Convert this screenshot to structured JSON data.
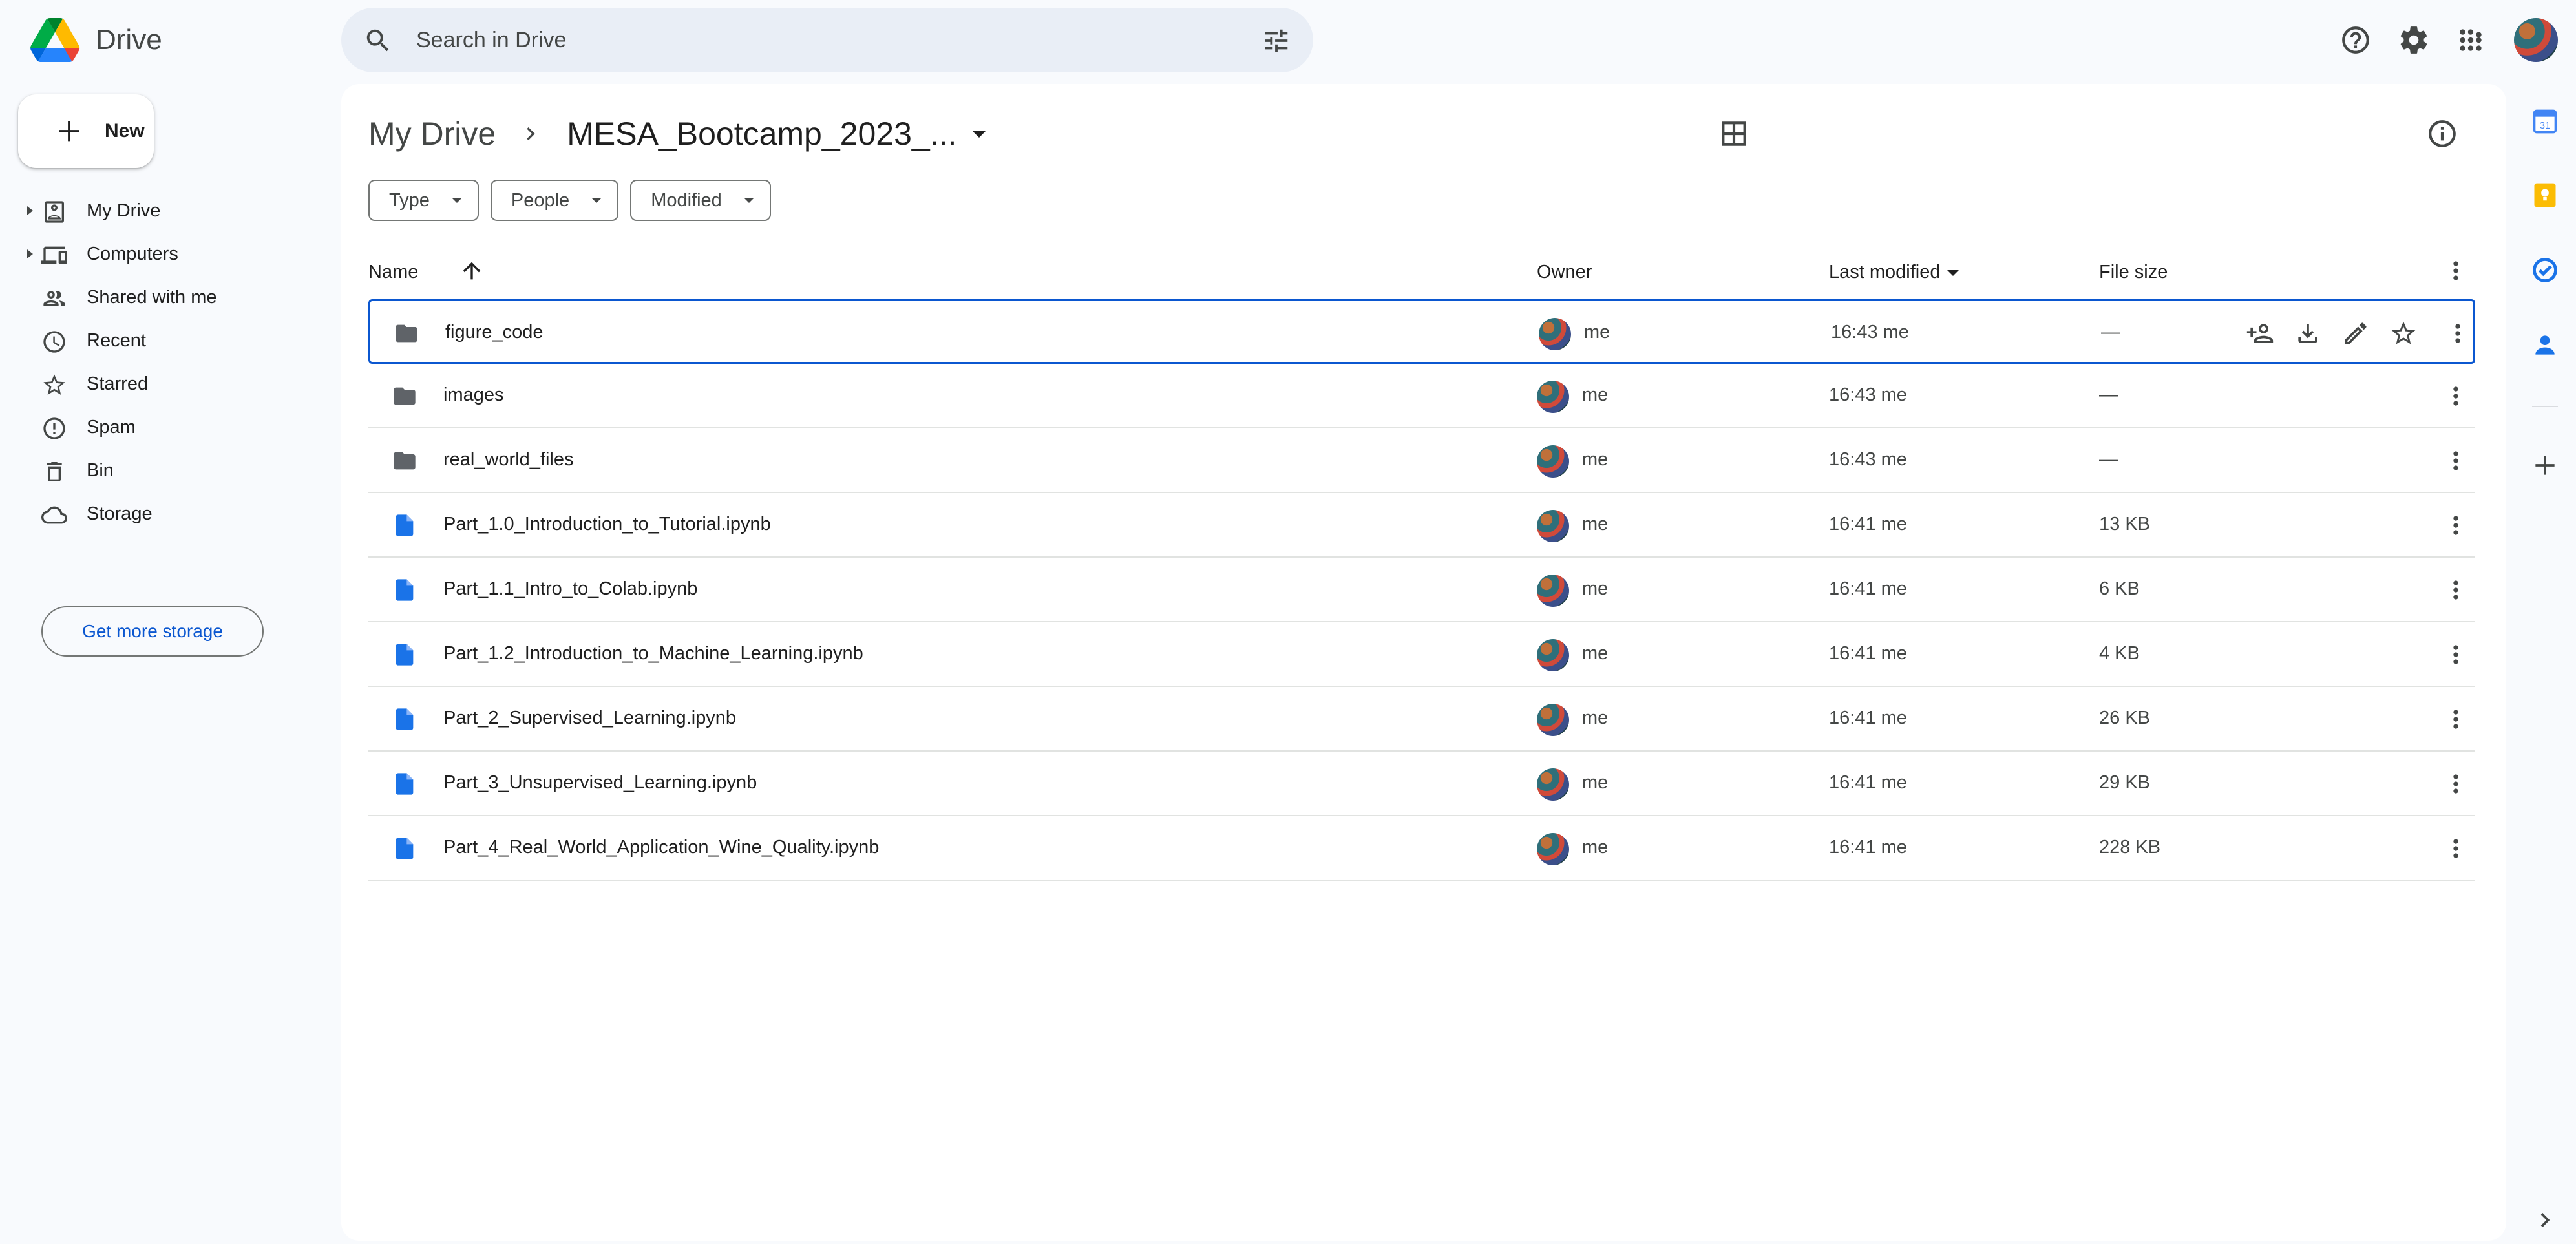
{
  "app": {
    "name": "Drive"
  },
  "search": {
    "placeholder": "Search in Drive"
  },
  "sidebar": {
    "new_label": "New",
    "items": [
      {
        "label": "My Drive",
        "icon": "my-drive-icon",
        "expandable": true
      },
      {
        "label": "Computers",
        "icon": "computers-icon",
        "expandable": true
      },
      {
        "label": "Shared with me",
        "icon": "shared-icon",
        "expandable": false
      },
      {
        "label": "Recent",
        "icon": "clock-icon",
        "expandable": false
      },
      {
        "label": "Starred",
        "icon": "star-icon",
        "expandable": false
      },
      {
        "label": "Spam",
        "icon": "spam-icon",
        "expandable": false
      },
      {
        "label": "Bin",
        "icon": "trash-icon",
        "expandable": false
      },
      {
        "label": "Storage",
        "icon": "cloud-icon",
        "expandable": false
      }
    ],
    "storage_button": "Get more storage"
  },
  "breadcrumb": {
    "root": "My Drive",
    "current": "MESA_Bootcamp_2023_..."
  },
  "filters": [
    "Type",
    "People",
    "Modified"
  ],
  "table": {
    "headers": {
      "name": "Name",
      "owner": "Owner",
      "modified": "Last modified",
      "size": "File size"
    },
    "rows": [
      {
        "type": "folder",
        "name": "figure_code",
        "owner": "me",
        "modified": "16:43 me",
        "size": "—",
        "selected": true
      },
      {
        "type": "folder",
        "name": "images",
        "owner": "me",
        "modified": "16:43 me",
        "size": "—"
      },
      {
        "type": "folder",
        "name": "real_world_files",
        "owner": "me",
        "modified": "16:43 me",
        "size": "—"
      },
      {
        "type": "doc",
        "name": "Part_1.0_Introduction_to_Tutorial.ipynb",
        "owner": "me",
        "modified": "16:41 me",
        "size": "13 KB"
      },
      {
        "type": "doc",
        "name": "Part_1.1_Intro_to_Colab.ipynb",
        "owner": "me",
        "modified": "16:41 me",
        "size": "6 KB"
      },
      {
        "type": "doc",
        "name": "Part_1.2_Introduction_to_Machine_Learning.ipynb",
        "owner": "me",
        "modified": "16:41 me",
        "size": "4 KB"
      },
      {
        "type": "doc",
        "name": "Part_2_Supervised_Learning.ipynb",
        "owner": "me",
        "modified": "16:41 me",
        "size": "26 KB"
      },
      {
        "type": "doc",
        "name": "Part_3_Unsupervised_Learning.ipynb",
        "owner": "me",
        "modified": "16:41 me",
        "size": "29 KB"
      },
      {
        "type": "doc",
        "name": "Part_4_Real_World_Application_Wine_Quality.ipynb",
        "owner": "me",
        "modified": "16:41 me",
        "size": "228 KB"
      }
    ]
  },
  "colors": {
    "accent": "#0b57d0",
    "search_bg": "#e9eef6",
    "page_bg": "#f8fafd",
    "folder": "#5f6368",
    "doc": "#1a73e8"
  }
}
